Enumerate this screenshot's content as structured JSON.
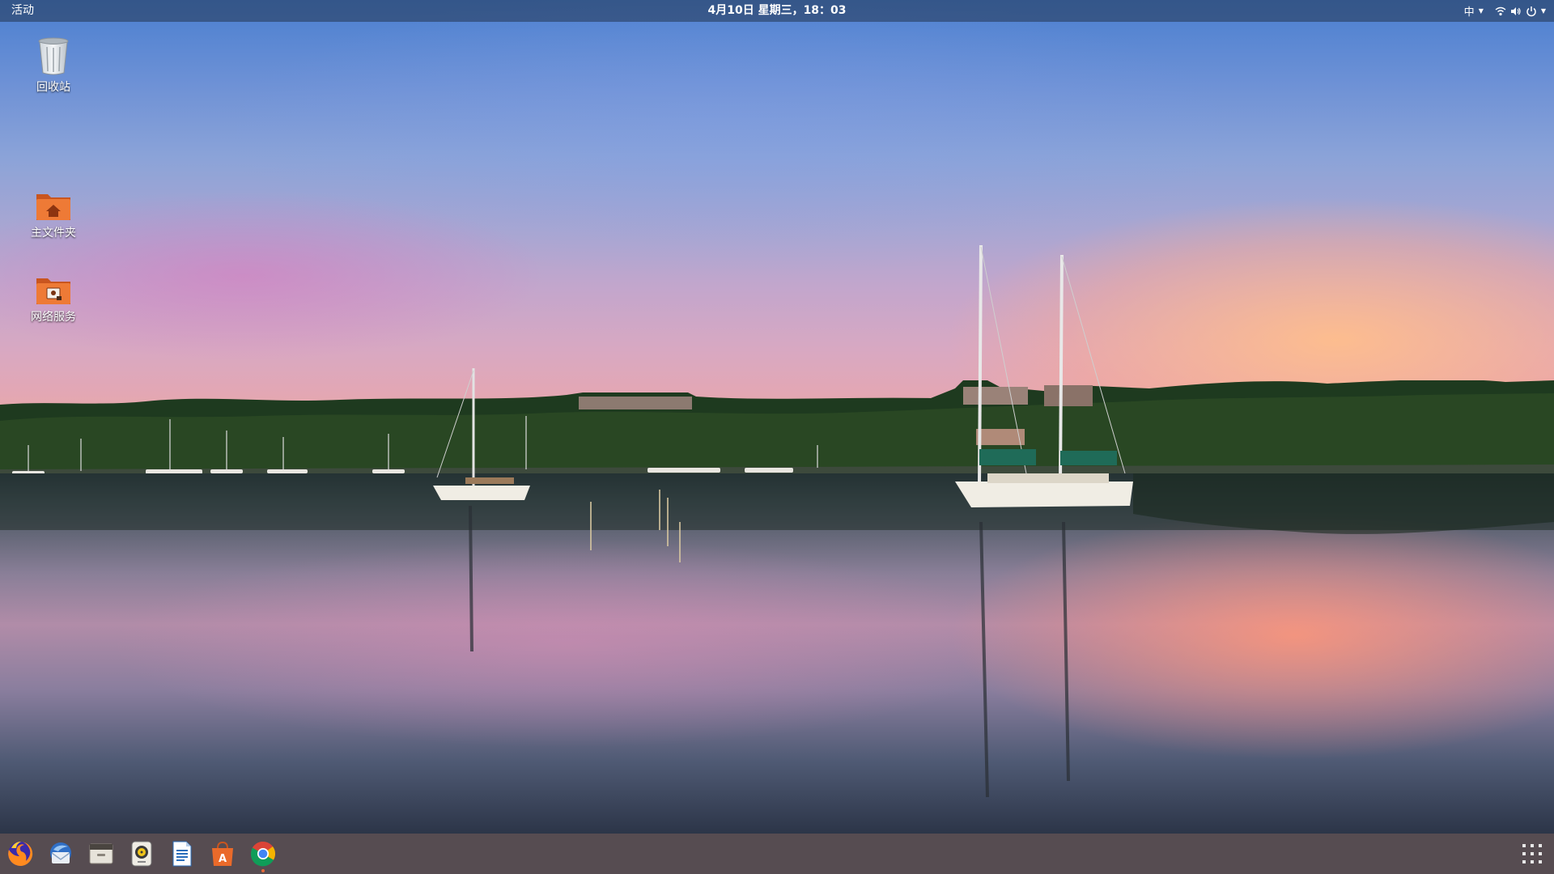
{
  "topbar": {
    "activities_label": "活动",
    "clock": "4月10日 星期三，18：03",
    "input_method": "中"
  },
  "desktop_icons": [
    {
      "label": "回收站",
      "icon": "trash-icon"
    },
    {
      "label": "主文件夹",
      "icon": "home-folder-icon"
    },
    {
      "label": "网络服务",
      "icon": "network-folder-icon"
    }
  ],
  "dock": {
    "apps": [
      {
        "name": "firefox",
        "icon": "firefox-icon",
        "running": false
      },
      {
        "name": "thunderbird",
        "icon": "thunderbird-icon",
        "running": false
      },
      {
        "name": "files",
        "icon": "files-icon",
        "running": false
      },
      {
        "name": "rhythmbox",
        "icon": "rhythmbox-icon",
        "running": false
      },
      {
        "name": "libreoffice-writer",
        "icon": "writer-icon",
        "running": false
      },
      {
        "name": "software-center",
        "icon": "software-center-icon",
        "running": false
      },
      {
        "name": "chrome",
        "icon": "chrome-icon",
        "running": true
      }
    ],
    "show_apps_icon": "app-grid-icon"
  },
  "colors": {
    "topbar_bg": "#233450",
    "dock_bg": "#2d323a",
    "folder_orange": "#e86d2c",
    "running_indicator": "#e66a3a"
  }
}
